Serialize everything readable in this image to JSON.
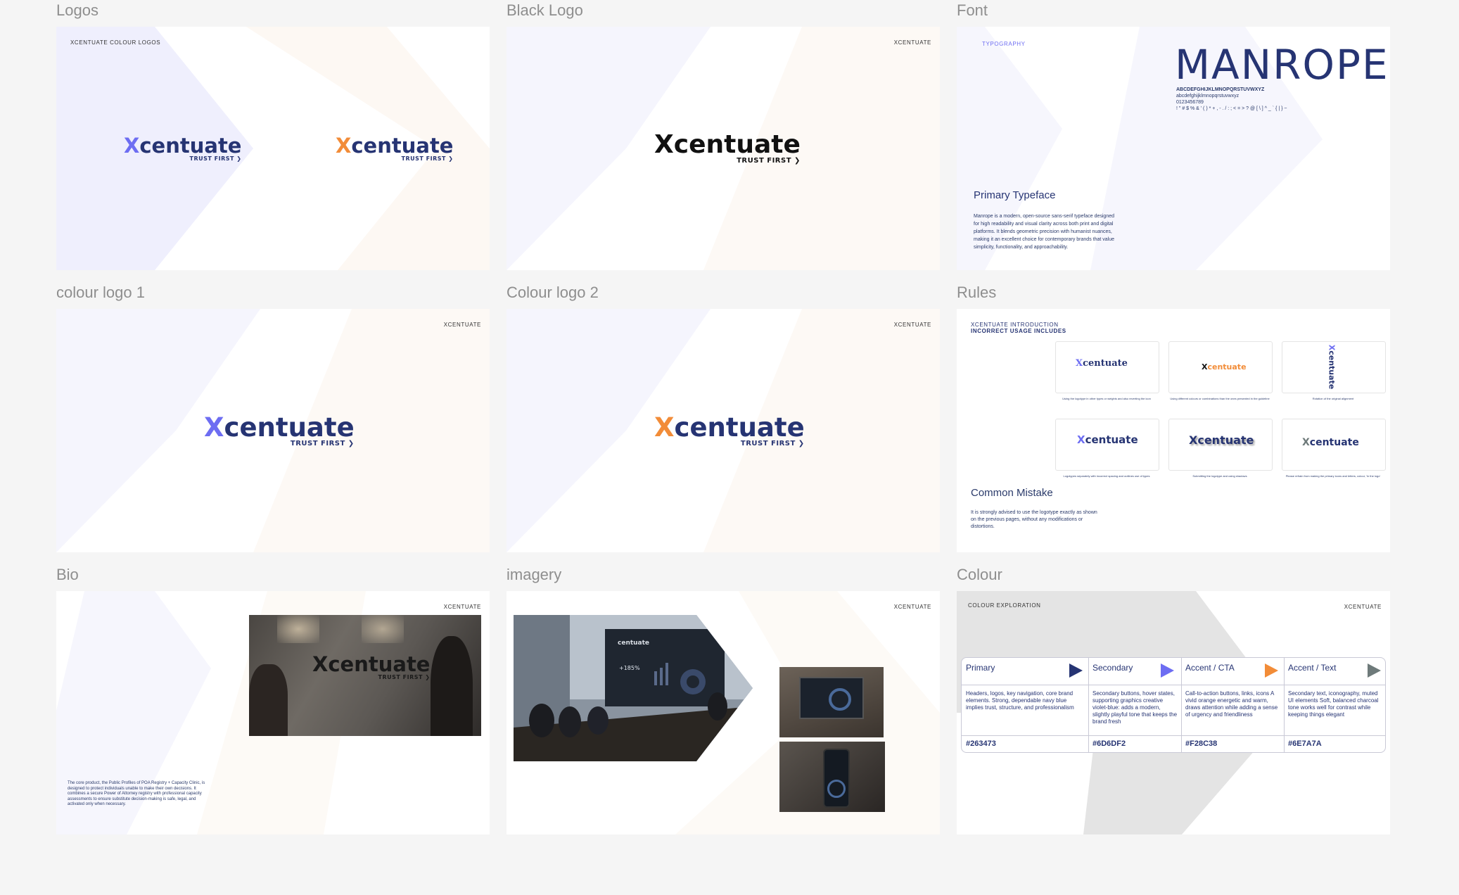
{
  "sections": {
    "logos": "Logos",
    "black_logo": "Black Logo",
    "font": "Font",
    "colour_logo_1": "colour logo 1",
    "colour_logo_2": "Colour logo 2",
    "rules": "Rules",
    "bio": "Bio",
    "imagery": "imagery",
    "colour": "Colour"
  },
  "brand": {
    "name": "XCENTUATE",
    "logo_x": "X",
    "logo_word": "centuate",
    "tagline": "TRUST FIRST ❯"
  },
  "logos_frame": {
    "heading": "XCENTUATE COLOUR LOGOS"
  },
  "font_frame": {
    "heading": "TYPOGRAPHY",
    "font_name": "MANROPE",
    "glyphs_upper": "ABCDEFGHIJKLMNOPQRSTUVWXYZ",
    "glyphs_lower": "abcdefghijklmnopqrstuvwxyz",
    "glyphs_digits": "0123456789",
    "glyphs_symbols": "! \" # $ % & ' ( ) * + , - . / : ; < = > ? @ [ \\ ] ^ _ ` { | } ~",
    "title": "Primary Typeface",
    "body": "Manrope is a modern, open-source sans-serif typeface designed for high readability and visual clarity across both print and digital platforms. It blends geometric precision with humanist nuances, making it an excellent choice for contemporary brands that value simplicity, functionality, and approachability."
  },
  "rules_frame": {
    "heading_1": "XCENTUATE INTRODUCTION",
    "heading_2": "INCORRECT USAGE INCLUDES",
    "title": "Common Mistake",
    "body": "It is strongly advised to use the logotype exactly as shown on the previous pages, without any modifications or distortions.",
    "captions": [
      "Using the logotype in other types or weights and also reverting the icon",
      "Using different colours or combinations than the ones presented in the guideline",
      "Rotation of the original alignment",
      "Logotypes separately with incorrect spacing and outlines use of types",
      "Submitting the logotype and using shadows",
      "Please refrain from making the primary icons and letters, colour, 'In the logo'"
    ]
  },
  "bio_frame": {
    "body": "The core product, the Public Profiles of POA Registry + Capacity Clinic, is designed to protect individuals unable to make their own decisions. It combines a secure Power of Attorney registry with professional capacity assessments to ensure substitute decision-making is safe, legal, and activated only when necessary."
  },
  "imagery_frame": {
    "screen_stat": "+185%"
  },
  "colour_frame": {
    "heading": "COLOUR EXPLORATION",
    "swatches": [
      {
        "name": "Primary",
        "desc": "Headers, logos, key navigation, core brand elements. Strong, dependable navy blue implies trust, structure, and professionalism",
        "hex": "#263473"
      },
      {
        "name": "Secondary",
        "desc": "Secondary buttons, hover states, supporting graphics creative violet-blue: adds a modern, slightly playful tone that keeps the brand fresh",
        "hex": "#6D6DF2"
      },
      {
        "name": "Accent / CTA",
        "desc": "Call-to-action buttons, links, icons A vivid orange energetic and warm, draws attention while adding a sense of urgency and friendliness",
        "hex": "#F28C38"
      },
      {
        "name": "Accent / Text",
        "desc": "Secondary text, iconography, muted UI elements Soft, balanced charcoal tone works well for contrast while keeping things elegant",
        "hex": "#6E7A7A"
      }
    ]
  },
  "colors": {
    "navy": "#263473",
    "violet": "#6D6DF2",
    "orange": "#F28C38",
    "charcoal": "#6E7A7A"
  }
}
